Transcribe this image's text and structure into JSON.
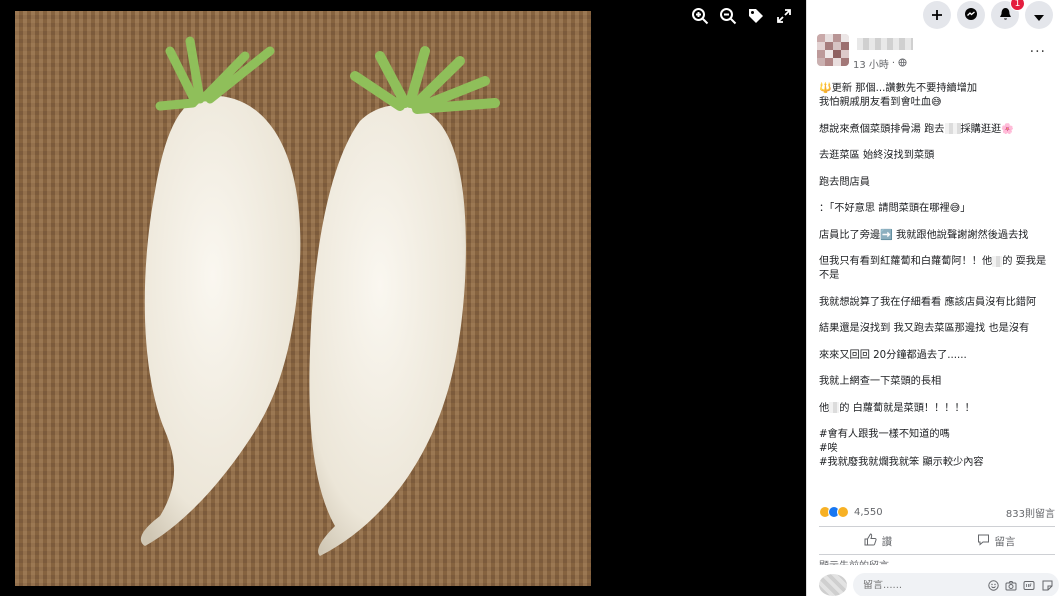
{
  "viewer": {
    "photo_alt": "",
    "tools": [
      {
        "name": "zoom-in-icon"
      },
      {
        "name": "zoom-out-icon"
      },
      {
        "name": "tag-icon"
      },
      {
        "name": "fullscreen-icon"
      }
    ]
  },
  "topbar": {
    "notification_count": "1",
    "icons": [
      "plus-icon",
      "messenger-icon",
      "bell-icon",
      "caret-down-icon"
    ]
  },
  "post": {
    "time": "13 小時",
    "more": "···",
    "lines": {
      "l1": "🔱更新 那個...讚數先不要持續增加",
      "l2": "我怕親戚朋友看到會吐血😅",
      "p2a": "想說來煮個菜頭排骨湯 跑去",
      "p2b": "採購逛逛🌸",
      "p3": "去逛菜區 始終沒找到菜頭",
      "p4": "跑去問店員",
      "p5": "：「不好意思 請問菜頭在哪裡😅」",
      "p6": "店員比了旁邊➡️ 我就跟他說聲謝謝然後過去找",
      "p7a": "但我只有看到紅蘿蔔和白蘿蔔阿！！他",
      "p7b": "的 耍我是不是",
      "p8": "我就想說算了我在仔細看看 應該店員沒有比錯阿",
      "p9": "結果還是沒找到 我又跑去菜區那邊找 也是沒有",
      "p10": "來來又回回 20分鐘都過去了......",
      "p11": "我就上網查一下菜頭的長相",
      "p12a": "他",
      "p12b": "的 白蘿蔔就是菜頭！！！！！",
      "h1": "#會有人跟我一樣不知道的嗎",
      "h2": "#唉",
      "h3": "#我就廢我就爛我就笨 顯示較少內容"
    },
    "reaction_count": "4,550",
    "comment_count": "833則留言",
    "like_label": "讚",
    "comment_label": "留言",
    "prev_comments": "顯示先前的留言",
    "composer_placeholder": "留言......"
  },
  "colors": {
    "burlap": "#8a6746",
    "radish": "#f2ede3",
    "stem": "#8fbf5a",
    "badge": "#e41e3f"
  }
}
